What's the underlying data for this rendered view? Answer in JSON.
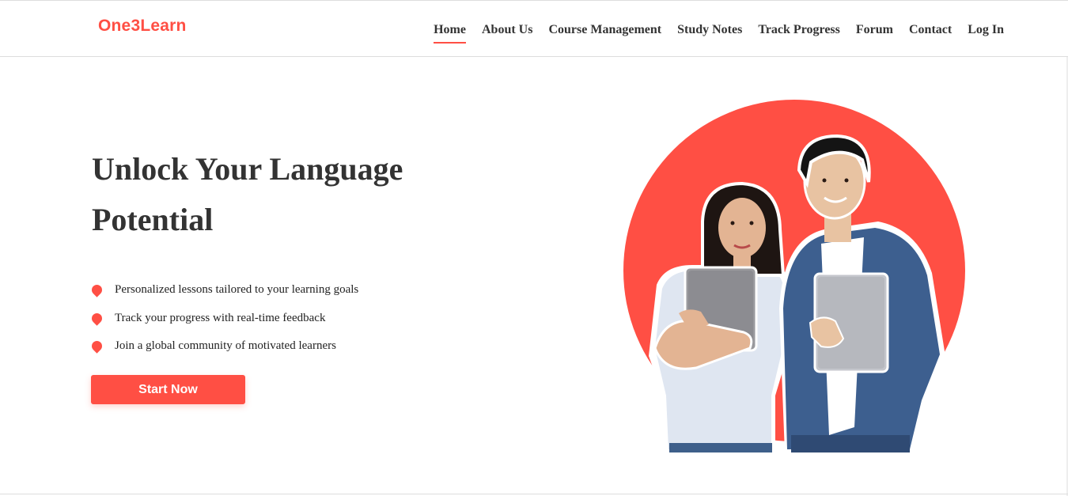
{
  "brand": {
    "logo_text": "One3Learn",
    "accent_color": "#ff4f44"
  },
  "nav": {
    "items": [
      {
        "label": "Home",
        "active": true
      },
      {
        "label": "About Us",
        "active": false
      },
      {
        "label": "Course Management",
        "active": false
      },
      {
        "label": "Study Notes",
        "active": false
      },
      {
        "label": "Track Progress",
        "active": false
      },
      {
        "label": "Forum",
        "active": false
      },
      {
        "label": "Contact",
        "active": false
      },
      {
        "label": "Log In",
        "active": false
      }
    ]
  },
  "hero": {
    "title": "Unlock Your Language Potential",
    "features": [
      {
        "icon": "location-pin-icon",
        "text": "Personalized lessons tailored to your learning goals"
      },
      {
        "icon": "location-pin-icon",
        "text": "Track your progress with real-time feedback"
      },
      {
        "icon": "location-pin-icon",
        "text": "Join a global community of motivated learners"
      }
    ],
    "cta_label": "Start Now",
    "image": {
      "subject": "two students holding laptops in front of red circle",
      "circle_color": "#ff4f44"
    }
  }
}
